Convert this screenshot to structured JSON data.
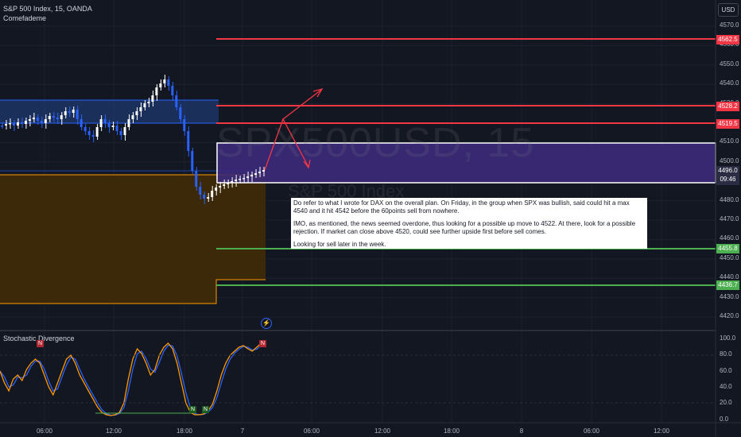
{
  "header": {
    "symbol_line": "S&P 500 Index, 15, OANDA",
    "indicator": "Comefademe"
  },
  "currency_button": "USD",
  "watermark": {
    "line1": "SPX500USD, 15",
    "line2": "S&P 500 Index"
  },
  "note": {
    "p1": "Do refer to what I wrote for DAX on the overall plan. On Friday, in the group when SPX was bullish, said could hit a max 4540 and it hit 4542 before the 60points sell from nowhere.",
    "p2": "IMO, as mentioned, the news seemed overdone, thus looking for a possible up move to 4522. At there, look for a possible rejection. If market can close above 4520, could see further upside first before sell comes.",
    "p3": "Looking for sell later in the week."
  },
  "price_axis": {
    "ticks": [
      "4570.0",
      "4560.0",
      "4550.0",
      "4540.0",
      "4530.0",
      "4520.0",
      "4510.0",
      "4500.0",
      "4490.0",
      "4480.0",
      "4470.0",
      "4460.0",
      "4450.0",
      "4440.0",
      "4430.0",
      "4420.0"
    ]
  },
  "price_labels": [
    {
      "value": "4562.5",
      "color": "#f23645"
    },
    {
      "value": "4528.2",
      "color": "#f23645"
    },
    {
      "value": "4519.5",
      "color": "#f23645"
    },
    {
      "value": "4496.0",
      "color": "#2b2b43",
      "sub": "09:46"
    },
    {
      "value": "4455.8",
      "color": "#4caf50"
    },
    {
      "value": "4436.7",
      "color": "#4caf50"
    }
  ],
  "stochastic": {
    "label": "Stochastic Divergence",
    "ticks": [
      "100.0",
      "80.0",
      "60.0",
      "40.0",
      "20.0",
      "0.0"
    ],
    "badge_text": "N",
    "colors": {
      "k": "#ff9800",
      "d": "#2962ff",
      "bear": "#b22833",
      "bull": "#1b5e20"
    }
  },
  "time_axis": [
    "06:00",
    "12:00",
    "18:00",
    "7",
    "06:00",
    "12:00",
    "18:00",
    "8",
    "06:00",
    "12:00"
  ],
  "colors": {
    "background": "#131722",
    "up": "#ffffff",
    "down": "#2962ff",
    "resistance": "#f23645",
    "support": "#4caf50",
    "supply_zone": "#1e3a6e",
    "demand_zone": "#3d2a0a",
    "target_box": "#3c2a7a"
  },
  "icons": {
    "alert": "lightning-icon"
  }
}
